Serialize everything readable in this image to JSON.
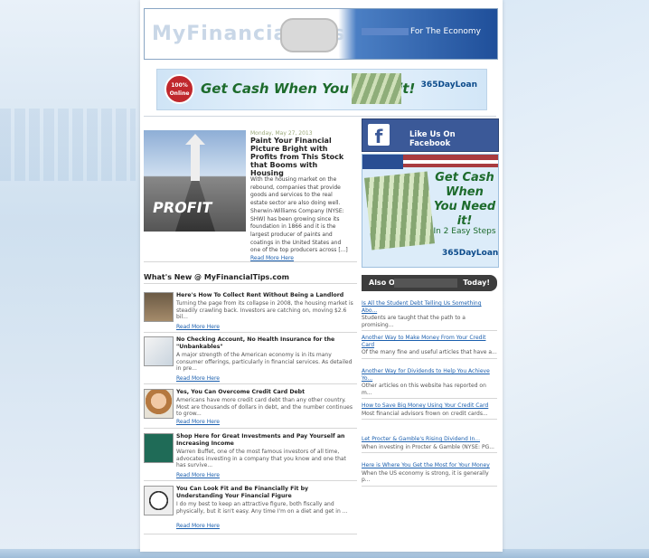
{
  "header": {
    "logo_text": "MyFinancialTips",
    "tagline": "For The Economy"
  },
  "top_ad": {
    "badge": "100% Online",
    "headline": "Get Cash When You Need it!",
    "brand": "365DayLoan"
  },
  "featured": {
    "date": "Monday, May 27, 2013",
    "title": "Paint Your Financial Picture Bright with Profits from This Stock that Booms with Housing",
    "image_label": "PROFIT",
    "body": "With the housing market on the rebound, companies that provide goods and services to the real estate sector are also doing well. Sherwin-Williams Company (NYSE: SHW) has been growing since its foundation in 1866 and it is the largest producer of paints and coatings in the United States and one of the top producers across [...]",
    "read_more": "Read More Here"
  },
  "whats_new": {
    "heading": "What's New @ MyFinancialTips.com",
    "items": [
      {
        "title": "Here's How To Collect Rent Without Being a Landlord",
        "body": "Turning the page from its collapse in 2008, the housing market is steadily crawling back. Investors are catching on, moving $2.6 bil...",
        "more": "Read More Here",
        "thumb": "for-rent-sign"
      },
      {
        "title": "No Checking Account, No Health Insurance for the \"Unbankables\"",
        "body": "A major strength of the American economy is in its many consumer offerings, particularly in financial services. As detailed in pre...",
        "more": "Read More Here",
        "thumb": "form-and-pen"
      },
      {
        "title": "Yes, You Can Overcome Credit Card Debt",
        "body": "Americans have more credit card debt than any other country. Most are thousands of dollars in debt, and the number continues to grow...",
        "more": "Read More Here",
        "thumb": "woman-face"
      },
      {
        "title": "Shop Here for Great Investments and Pay Yourself an Increasing Income",
        "body": "Warren Buffet, one of the most famous investors of all time, advocates investing in a company that you know and one that has survive...",
        "more": "Read More Here",
        "thumb": "return-on-equity"
      },
      {
        "title": "You Can Look Fit and Be Financially Fit by Understanding Your Financial Figure",
        "body": "I do my best to keep an attractive figure, both fiscally and physically, but it isn't easy.  Any time I'm on a diet and get in ...",
        "more": "Read More Here",
        "thumb": "scale"
      }
    ]
  },
  "sidebar": {
    "facebook": "Like Us On Facebook",
    "ad_headline": "Get Cash When You Need it!",
    "ad_sub": "In 2 Easy Steps",
    "ad_brand": "365DayLoan",
    "also_on_left": "Also On",
    "also_on_right": "Today!",
    "links": [
      {
        "title": "Is All the Student Debt Telling Us Something Abo...",
        "desc": "Students are taught that the path to a promising..."
      },
      {
        "title": "Another Way to Make Money From Your Credit Card",
        "desc": "Of the many fine and useful articles that have a..."
      },
      {
        "title": "Another Way for Dividends to Help You Achieve Yo...",
        "desc": "Other articles on this website has reported on m..."
      },
      {
        "title": "How to Save Big Money Using Your Credit Card",
        "desc": "Most financial advisors frown on credit cards..."
      },
      {
        "title": "Let Procter & Gamble's Rising Dividend In...",
        "desc": "When investing in Procter & Gamble (NYSE: PG..."
      },
      {
        "title": "Here is Where You Get the Most for Your Money",
        "desc": "When the US economy is strong, it is generally p..."
      }
    ]
  }
}
